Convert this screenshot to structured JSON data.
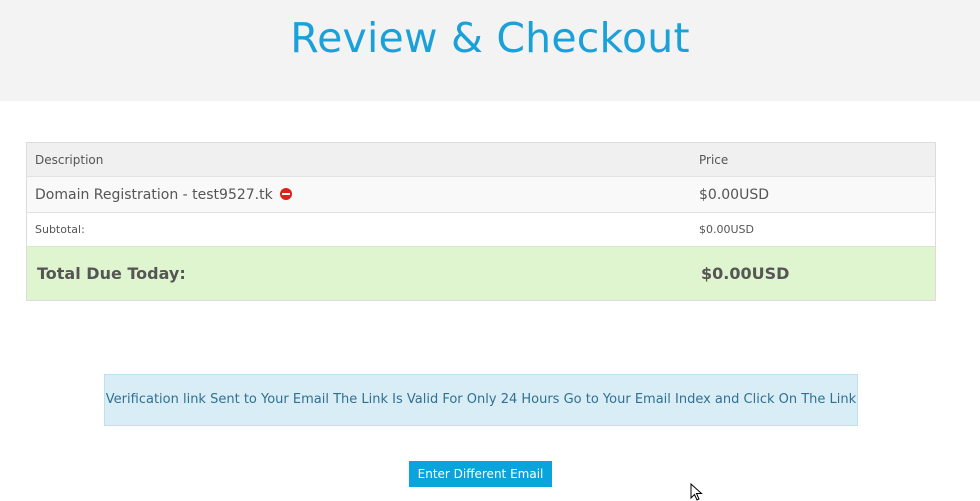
{
  "header": {
    "title": "Review & Checkout"
  },
  "cart": {
    "columns": {
      "description": "Description",
      "price": "Price"
    },
    "items": [
      {
        "description": "Domain Registration - test9527.tk",
        "price": "$0.00USD",
        "remove_icon": "remove-circle-icon"
      }
    ],
    "subtotal": {
      "label": "Subtotal:",
      "value": "$0.00USD"
    },
    "total": {
      "label": "Total Due Today:",
      "value": "$0.00USD"
    }
  },
  "alert": {
    "message": "Verification link Sent to Your Email The Link Is Valid For Only 24 Hours Go to Your Email Index and Click On The Link"
  },
  "actions": {
    "different_email_label": "Enter Different Email"
  },
  "colors": {
    "title": "#1aa1d9",
    "button": "#0aa4dc",
    "total_bg": "#dff5cf",
    "alert_bg": "#d9edf7",
    "remove_icon": "#d9231c"
  }
}
